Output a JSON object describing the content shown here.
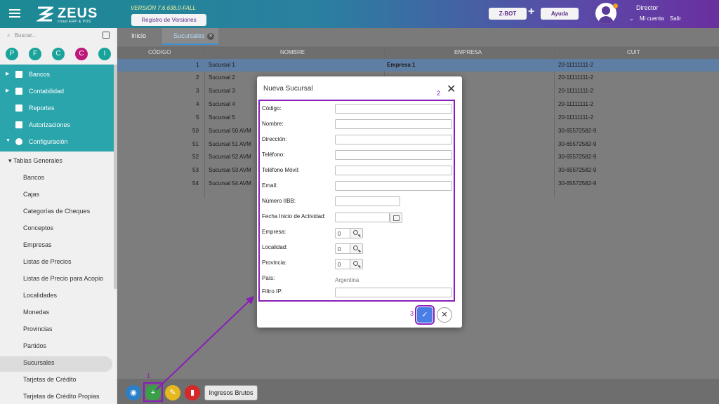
{
  "header": {
    "logo_text": "ZEUS",
    "logo_sub": "cloud ERP & POS",
    "version": "VERSIÓN 7.6.638.0-FALL",
    "registro_label": "Registro de Versiones",
    "zbot_label": "Z-BOT",
    "plus": "+",
    "ayuda_label": "Ayuda",
    "user_name": "Director",
    "mi_cuenta": "Mi cuenta",
    "salir": "Salir"
  },
  "sidebar": {
    "search_placeholder": "Buscar...",
    "circles": [
      {
        "letter": "P",
        "color": "#1aa39a"
      },
      {
        "letter": "F",
        "color": "#1aa39a"
      },
      {
        "letter": "C",
        "color": "#1aa39a"
      },
      {
        "letter": "C",
        "color": "#c0187a"
      },
      {
        "letter": "I",
        "color": "#1aa39a"
      }
    ],
    "nav": [
      "Bancos",
      "Contabilidad",
      "Reportes",
      "Autorizaciones",
      "Configuración"
    ],
    "group": "Tablas Generales",
    "items": [
      "Bancos",
      "Cajas",
      "Categorías de Cheques",
      "Conceptos",
      "Empresas",
      "Listas de Precios",
      "Listas de Precio para Acopio",
      "Localidades",
      "Monedas",
      "Provincias",
      "Partidos",
      "Sucursales",
      "Tarjetas de Crédito",
      "Tarjetas de Crédito Propias"
    ]
  },
  "tabs": [
    "Inicio",
    "Sucursales"
  ],
  "table": {
    "headers": [
      "CÓDIGO",
      "NOMBRE",
      "EMPRESA",
      "CUIT"
    ],
    "rows": [
      [
        "1",
        "Sucursal 1",
        "Empresa 1",
        "20-11111111-2"
      ],
      [
        "2",
        "Sucursal 2",
        "",
        "20-11111111-2"
      ],
      [
        "3",
        "Sucursal 3",
        "",
        "20-11111111-2"
      ],
      [
        "4",
        "Sucursal 4",
        "",
        "20-11111111-2"
      ],
      [
        "5",
        "Sucursal 5",
        "",
        "20-11111111-2"
      ],
      [
        "50",
        "Sucursal 50 AVM",
        "",
        "30-65572582-9"
      ],
      [
        "51",
        "Sucursal 51 AVM",
        "",
        "30-65572582-9"
      ],
      [
        "52",
        "Sucursal 52 AVM",
        "",
        "30-65572582-9"
      ],
      [
        "53",
        "Sucursal 53 AVM",
        "",
        "30-65572582-9"
      ],
      [
        "54",
        "Sucursal 54 AVM",
        "",
        "30-65572582-9"
      ]
    ]
  },
  "bottom": {
    "ingresos_label": "Ingresos Brutos"
  },
  "modal": {
    "title": "Nueva Sucursal",
    "labels": [
      "Código:",
      "Nombre:",
      "Dirección:",
      "Teléfono:",
      "Teléfono Móvil:",
      "Email:",
      "Número IIBB:",
      "Fecha Inicio de Actividad:",
      "Empresa:",
      "Localidad:",
      "Provincia:",
      "País:",
      "Filtro IP:"
    ],
    "empresa_value": "0",
    "localidad_value": "0",
    "provincia_value": "0",
    "pais_value": "Argentina"
  },
  "annotations": [
    "1",
    "2",
    "3"
  ]
}
